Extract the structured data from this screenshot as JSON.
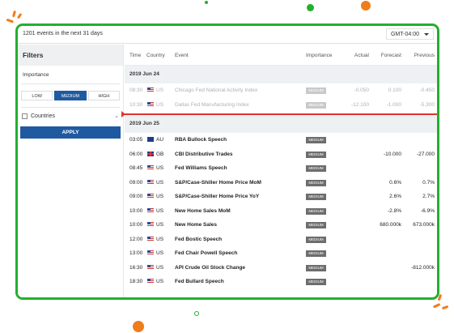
{
  "colors": {
    "frame": "#22b02d",
    "accent": "#1f5aa0",
    "deco_orange": "#f07c1a",
    "now_line": "#e0342f"
  },
  "topbar": {
    "events_count": "1201 events in the next 31 days",
    "timezone": "GMT-04:00"
  },
  "filters": {
    "title": "Filters",
    "importance_label": "Importance",
    "importance_options": [
      "LOW",
      "MEDIUM",
      "HIGH"
    ],
    "selected_importance": "MEDIUM",
    "countries_label": "Countries",
    "apply_label": "APPLY"
  },
  "table": {
    "headers": {
      "time": "Time",
      "country": "Country",
      "event": "Event",
      "importance": "Importance",
      "actual": "Actual",
      "forecast": "Forecast",
      "previous": "Previous"
    },
    "groups": [
      {
        "date": "2019 Jun 24",
        "rows": [
          {
            "time": "08:30",
            "country": "US",
            "flag": "us",
            "event": "Chicago Fed National Activity Index",
            "importance": "MEDIUM",
            "actual": "-0.050",
            "forecast": "0.100",
            "previous": "-0.450"
          },
          {
            "time": "10:30",
            "country": "US",
            "flag": "us",
            "event": "Dallas Fed Manufacturing Index",
            "importance": "MEDIUM",
            "actual": "-12.100",
            "forecast": "-1.000",
            "previous": "-5.300"
          }
        ]
      },
      {
        "date": "2019 Jun 25",
        "rows": [
          {
            "time": "03:05",
            "country": "AU",
            "flag": "au",
            "event": "RBA Bullock Speech",
            "importance": "MEDIUM",
            "actual": "",
            "forecast": "",
            "previous": ""
          },
          {
            "time": "06:00",
            "country": "GB",
            "flag": "gb",
            "event": "CBI Distributive Trades",
            "importance": "MEDIUM",
            "actual": "",
            "forecast": "-10.000",
            "previous": "-27.000"
          },
          {
            "time": "08:45",
            "country": "US",
            "flag": "us",
            "event": "Fed Williams Speech",
            "importance": "MEDIUM",
            "actual": "",
            "forecast": "",
            "previous": ""
          },
          {
            "time": "09:00",
            "country": "US",
            "flag": "us",
            "event": "S&P/Case-Shiller Home Price MoM",
            "importance": "MEDIUM",
            "actual": "",
            "forecast": "0.6%",
            "previous": "0.7%"
          },
          {
            "time": "09:00",
            "country": "US",
            "flag": "us",
            "event": "S&P/Case-Shiller Home Price YoY",
            "importance": "MEDIUM",
            "actual": "",
            "forecast": "2.6%",
            "previous": "2.7%"
          },
          {
            "time": "10:00",
            "country": "US",
            "flag": "us",
            "event": "New Home Sales MoM",
            "importance": "MEDIUM",
            "actual": "",
            "forecast": "-2.8%",
            "previous": "-6.9%"
          },
          {
            "time": "10:00",
            "country": "US",
            "flag": "us",
            "event": "New Home Sales",
            "importance": "MEDIUM",
            "actual": "",
            "forecast": "680.000k",
            "previous": "673.000k"
          },
          {
            "time": "12:00",
            "country": "US",
            "flag": "us",
            "event": "Fed Bostic Speech",
            "importance": "MEDIUM",
            "actual": "",
            "forecast": "",
            "previous": ""
          },
          {
            "time": "13:00",
            "country": "US",
            "flag": "us",
            "event": "Fed Chair Powell Speech",
            "importance": "MEDIUM",
            "actual": "",
            "forecast": "",
            "previous": ""
          },
          {
            "time": "16:30",
            "country": "US",
            "flag": "us",
            "event": "API Crude Oil Stock Change",
            "importance": "MEDIUM",
            "actual": "",
            "forecast": "",
            "previous": "-812.000k"
          },
          {
            "time": "18:30",
            "country": "US",
            "flag": "us",
            "event": "Fed Bullard Speech",
            "importance": "MEDIUM",
            "actual": "",
            "forecast": "",
            "previous": ""
          }
        ]
      }
    ]
  }
}
